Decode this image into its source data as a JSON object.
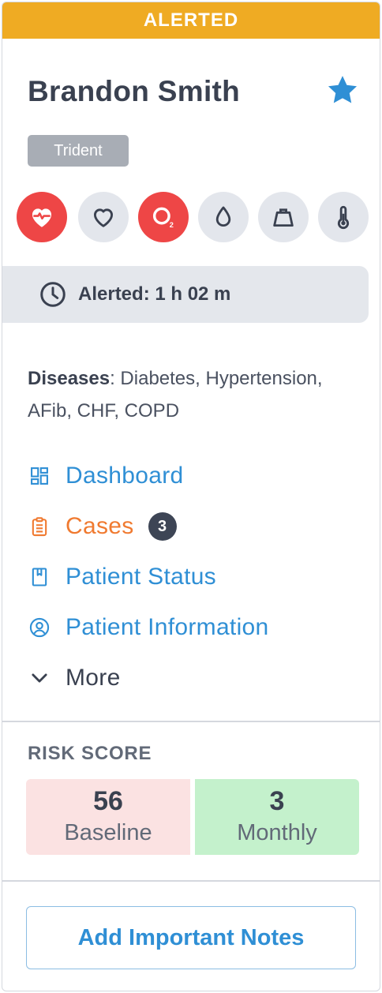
{
  "banner": {
    "status": "ALERTED"
  },
  "patient": {
    "name": "Brandon Smith",
    "program_tag": "Trident"
  },
  "vitals": [
    {
      "icon": "heart-rate-icon",
      "alert": true
    },
    {
      "icon": "heart-icon",
      "alert": false
    },
    {
      "icon": "oxygen-icon",
      "alert": true
    },
    {
      "icon": "blood-drop-icon",
      "alert": false
    },
    {
      "icon": "weight-icon",
      "alert": false
    },
    {
      "icon": "thermometer-icon",
      "alert": false
    }
  ],
  "alert_time": {
    "text": "Alerted: 1 h 02 m"
  },
  "diseases": {
    "label": "Diseases",
    "value": ": Diabetes, Hypertension, AFib, CHF, COPD"
  },
  "links": {
    "dashboard": "Dashboard",
    "cases": "Cases",
    "cases_count": "3",
    "patient_status": "Patient Status",
    "patient_information": "Patient Information",
    "more": "More"
  },
  "risk": {
    "title": "RISK SCORE",
    "baseline_value": "56",
    "baseline_label": "Baseline",
    "monthly_value": "3",
    "monthly_label": "Monthly"
  },
  "notes_button": "Add Important Notes",
  "colors": {
    "banner": "#efab23",
    "alert_red": "#ee4646",
    "link_blue": "#2f8fd5",
    "cases_orange": "#f07a30",
    "star_blue": "#2f8fd5"
  }
}
